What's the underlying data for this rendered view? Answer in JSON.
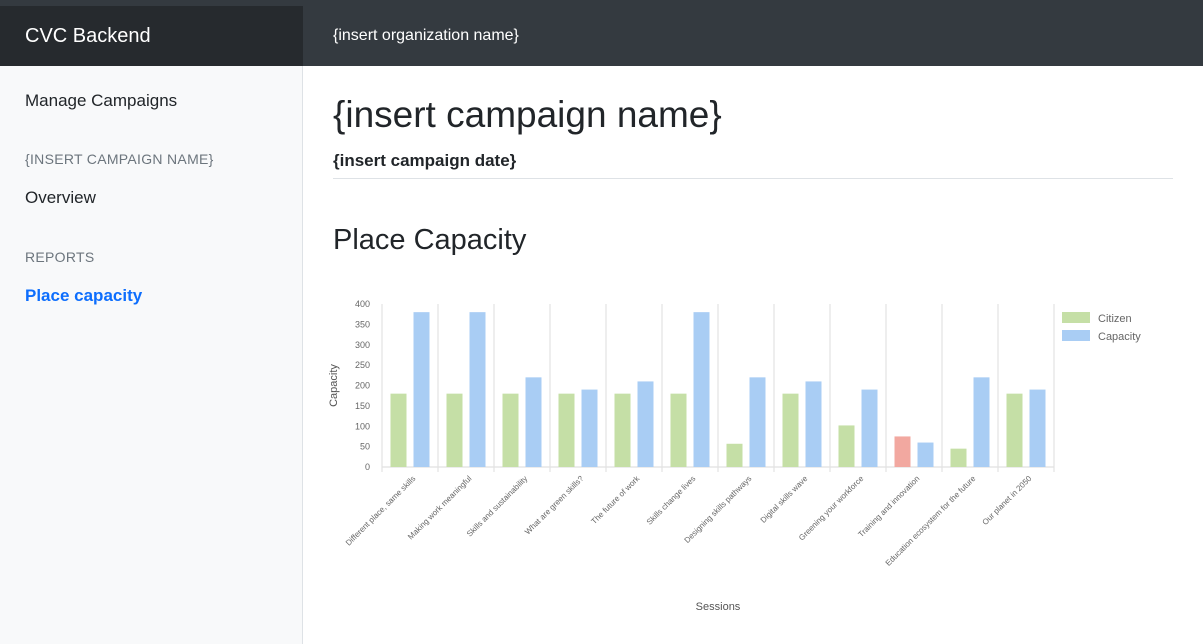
{
  "topbar": {
    "brand": "CVC Backend",
    "organization": "{insert organization name}"
  },
  "sidebar": {
    "manage_campaigns": "Manage Campaigns",
    "campaign_heading": "{INSERT CAMPAIGN NAME}",
    "overview": "Overview",
    "reports_heading": "REPORTS",
    "place_capacity": "Place capacity"
  },
  "main": {
    "campaign_name": "{insert campaign name}",
    "campaign_date": "{insert campaign date}",
    "section_title": "Place Capacity"
  },
  "colors": {
    "citizen": "#c5dfa6",
    "citizen_over": "#f2a8a0",
    "capacity": "#a9cdf4",
    "active_link": "#0d6efd"
  },
  "chart_data": {
    "type": "bar",
    "xlabel": "Sessions",
    "ylabel": "Capacity",
    "ylim": [
      0,
      400
    ],
    "yticks": [
      0,
      50,
      100,
      150,
      200,
      250,
      300,
      350,
      400
    ],
    "legend_position": "right",
    "categories": [
      "Different place, same skills",
      "Making work meaningful",
      "Skills and sustainability",
      "What are green skills?",
      "The future of work",
      "Skills change lives",
      "Designing skills pathways",
      "Digital skills wave",
      "Greening your workforce",
      "Training and innovation",
      "Education ecosystem for the future",
      "Our planet in 2050"
    ],
    "series": [
      {
        "name": "Citizen",
        "values": [
          180,
          180,
          180,
          180,
          180,
          180,
          57,
          180,
          102,
          75,
          45,
          180
        ]
      },
      {
        "name": "Capacity",
        "values": [
          380,
          380,
          220,
          190,
          210,
          380,
          220,
          210,
          190,
          60,
          220,
          190
        ]
      }
    ]
  }
}
